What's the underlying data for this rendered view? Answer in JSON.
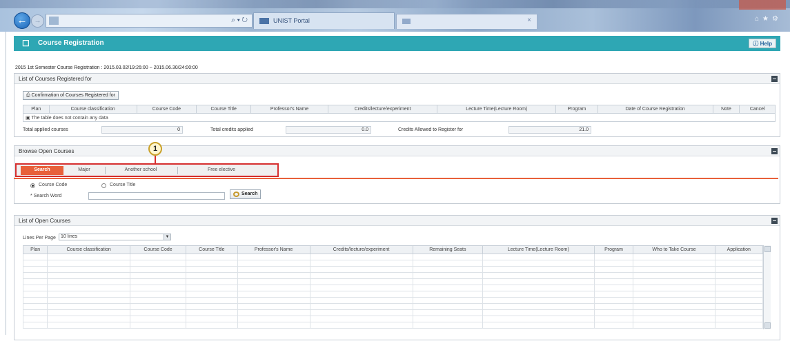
{
  "browser": {
    "tab_title": "UNIST Portal",
    "nav_controls": "⌕ ▾ ↻"
  },
  "header": {
    "title": "Course Registration",
    "help_label": "Help"
  },
  "registration_period": "2015 1st Semester Course Registration : 2015.03.02/19:26:00 ~ 2015.06.30/24:00:00",
  "registered": {
    "title": "List of Courses Registered for",
    "confirm_button": "Confirmation of Courses Registered for",
    "columns": [
      "Plan",
      "Course classification",
      "Course Code",
      "Course Title",
      "Professor's Name",
      "Credits/lecture/experiment",
      "Lecture Time(Lecture Room)",
      "Program",
      "Date of Course Registration",
      "Note",
      "Cancel"
    ],
    "empty_message": "The table does not contain any data",
    "stats": {
      "total_courses_label": "Total applied courses",
      "total_courses_value": "0",
      "total_credits_label": "Total credits applied",
      "total_credits_value": "0.0",
      "allowed_label": "Credits Allowed to Register for",
      "allowed_value": "21.0"
    }
  },
  "browse": {
    "title": "Browse Open Courses",
    "callout_number": "1",
    "tabs": [
      "Search",
      "Major",
      "Another school",
      "Free elective"
    ],
    "active_tab": "Search",
    "radio_course_code": "Course Code",
    "radio_course_title": "Course Title",
    "search_word_label": "* Search Word",
    "search_button": "Search"
  },
  "open_courses": {
    "title": "List of Open Courses",
    "lines_per_page_label": "Lines Per Page",
    "lines_per_page_value": "10 lines",
    "columns": [
      "Plan",
      "Course classification",
      "Course Code",
      "Course Title",
      "Professor's Name",
      "Credits/lecture/experiment",
      "Remaining Seats",
      "Lecture Time(Lecture Room)",
      "Program",
      "Who to Take Course",
      "Application"
    ]
  },
  "colors": {
    "header_teal": "#2ea7b4",
    "active_tab": "#e8603a",
    "highlight_red": "#d62e2e"
  }
}
